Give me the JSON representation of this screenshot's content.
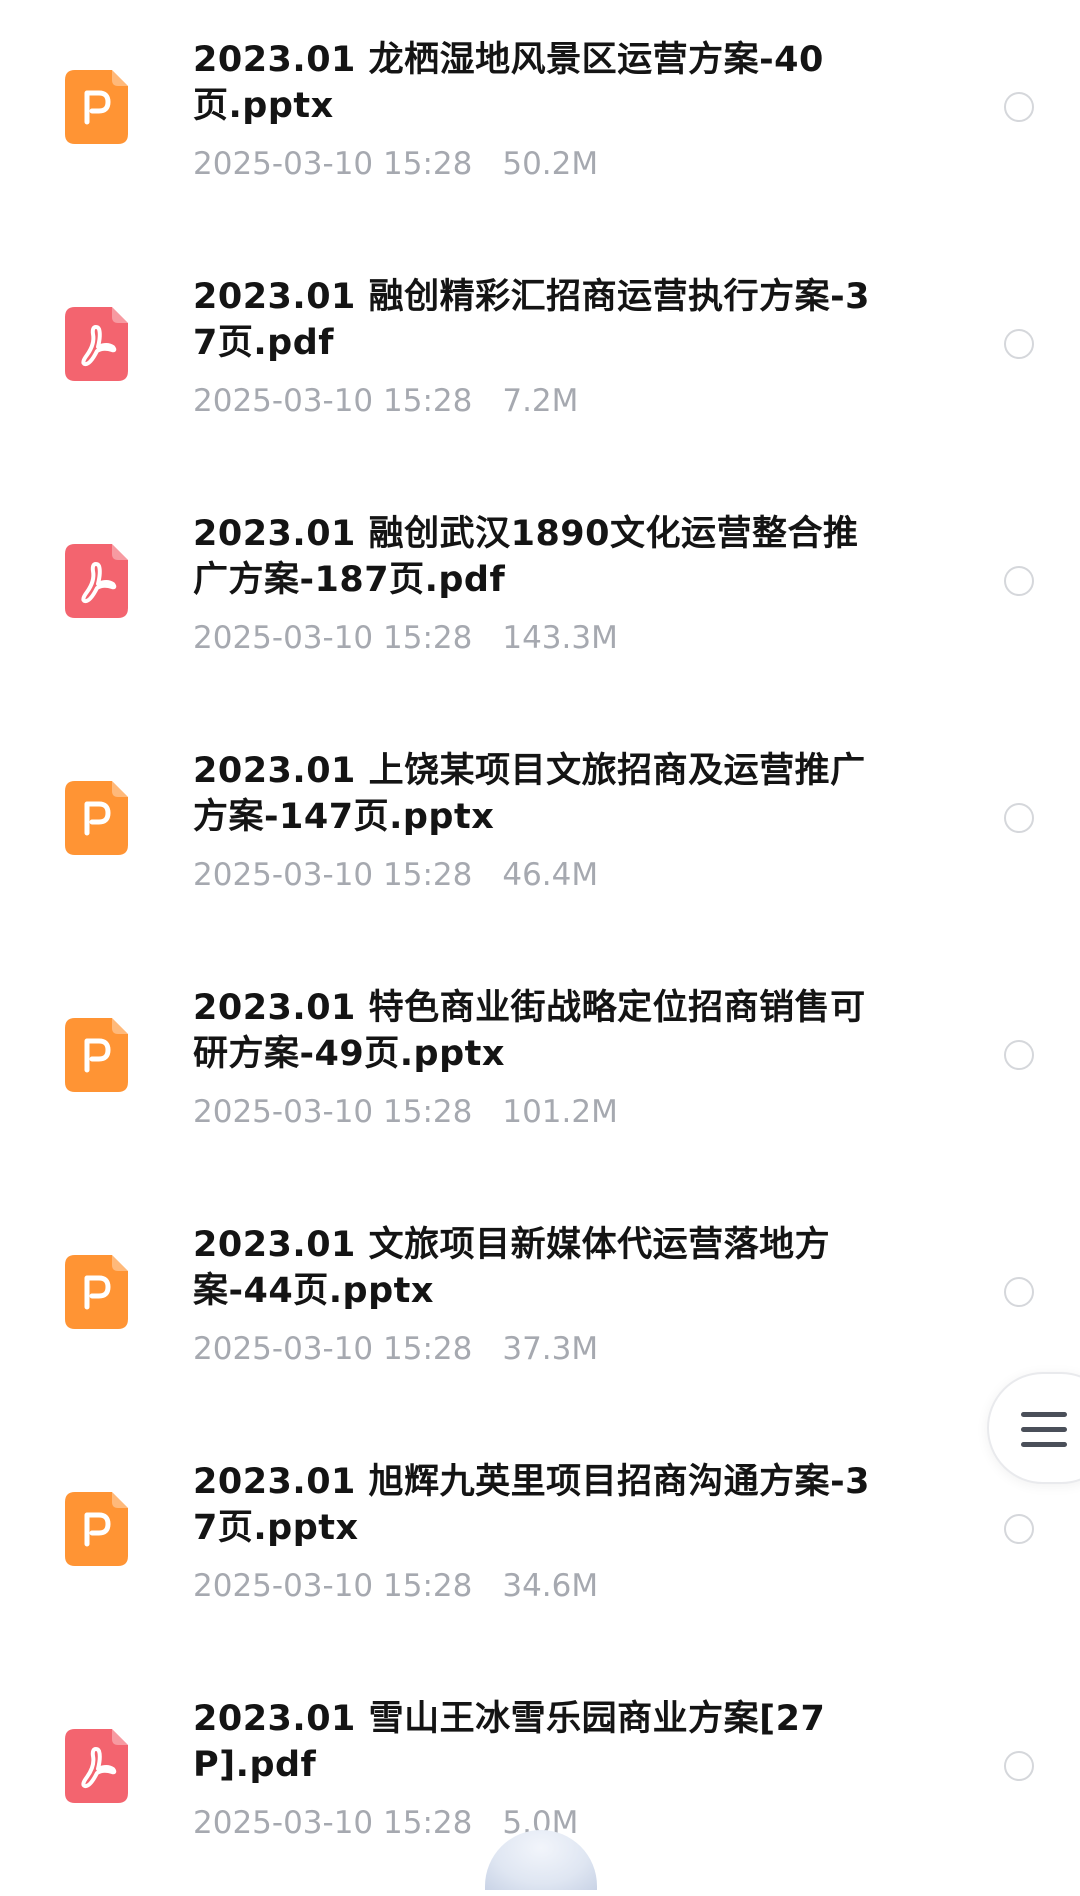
{
  "colors": {
    "pptx_icon": "#ff9434",
    "pdf_icon": "#f3646f",
    "title_text": "#141414",
    "meta_text": "#a6a9b0",
    "radio_border": "#d5d7db"
  },
  "files": [
    {
      "name": "2023.01 龙栖湿地风景区运营方案-40页.pptx",
      "date": "2025-03-10 15:28",
      "size": "50.2M",
      "type": "pptx",
      "icon": "ppt-file-icon"
    },
    {
      "name": "2023.01 融创精彩汇招商运营执行方案-37页.pdf",
      "date": "2025-03-10 15:28",
      "size": "7.2M",
      "type": "pdf",
      "icon": "pdf-file-icon"
    },
    {
      "name": "2023.01 融创武汉1890文化运营整合推广方案-187页.pdf",
      "date": "2025-03-10 15:28",
      "size": "143.3M",
      "type": "pdf",
      "icon": "pdf-file-icon"
    },
    {
      "name": "2023.01 上饶某项目文旅招商及运营推广方案-147页.pptx",
      "date": "2025-03-10 15:28",
      "size": "46.4M",
      "type": "pptx",
      "icon": "ppt-file-icon"
    },
    {
      "name": "2023.01 特色商业街战略定位招商销售可研方案-49页.pptx",
      "date": "2025-03-10 15:28",
      "size": "101.2M",
      "type": "pptx",
      "icon": "ppt-file-icon"
    },
    {
      "name": "2023.01 文旅项目新媒体代运营落地方案-44页.pptx",
      "date": "2025-03-10 15:28",
      "size": "37.3M",
      "type": "pptx",
      "icon": "ppt-file-icon"
    },
    {
      "name": "2023.01 旭辉九英里项目招商沟通方案-37页.pptx",
      "date": "2025-03-10 15:28",
      "size": "34.6M",
      "type": "pptx",
      "icon": "ppt-file-icon"
    },
    {
      "name": "2023.01 雪山王冰雪乐园商业方案[27P].pdf",
      "date": "2025-03-10 15:28",
      "size": "5.0M",
      "type": "pdf",
      "icon": "pdf-file-icon"
    }
  ],
  "floating_menu": {
    "icon": "menu-icon"
  }
}
